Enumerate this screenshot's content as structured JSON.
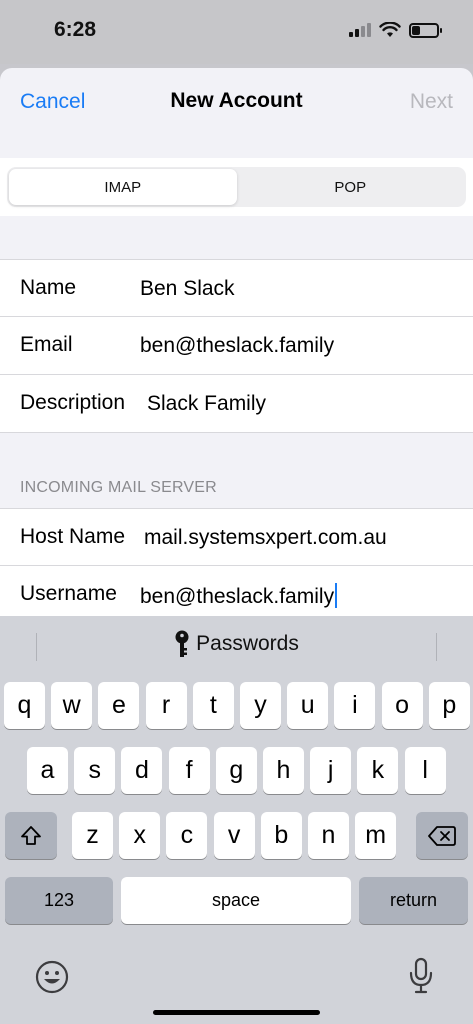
{
  "status": {
    "time": "6:28",
    "battery_level": 0.35
  },
  "nav": {
    "cancel": "Cancel",
    "title": "New Account",
    "next": "Next"
  },
  "segment": {
    "options": [
      "IMAP",
      "POP"
    ],
    "selected": "IMAP"
  },
  "account": {
    "rows": [
      {
        "label": "Name",
        "value": "Ben Slack"
      },
      {
        "label": "Email",
        "value": "ben@theslack.family"
      },
      {
        "label": "Description",
        "value": "Slack Family"
      }
    ]
  },
  "incoming": {
    "header": "INCOMING MAIL SERVER",
    "rows": [
      {
        "label": "Host Name",
        "value": "mail.systemsxpert.com.au"
      },
      {
        "label": "Username",
        "value": "ben@theslack.family"
      }
    ]
  },
  "keyboard": {
    "suggestion": "Passwords",
    "row1": [
      "q",
      "w",
      "e",
      "r",
      "t",
      "y",
      "u",
      "i",
      "o",
      "p"
    ],
    "row2": [
      "a",
      "s",
      "d",
      "f",
      "g",
      "h",
      "j",
      "k",
      "l"
    ],
    "row3": [
      "z",
      "x",
      "c",
      "v",
      "b",
      "n",
      "m"
    ],
    "numbers_key": "123",
    "space_key": "space",
    "return_key": "return"
  },
  "icons": {
    "shift": "shift-icon",
    "delete": "delete-icon",
    "emoji": "emoji-icon",
    "mic": "microphone-icon",
    "key": "key-icon"
  }
}
